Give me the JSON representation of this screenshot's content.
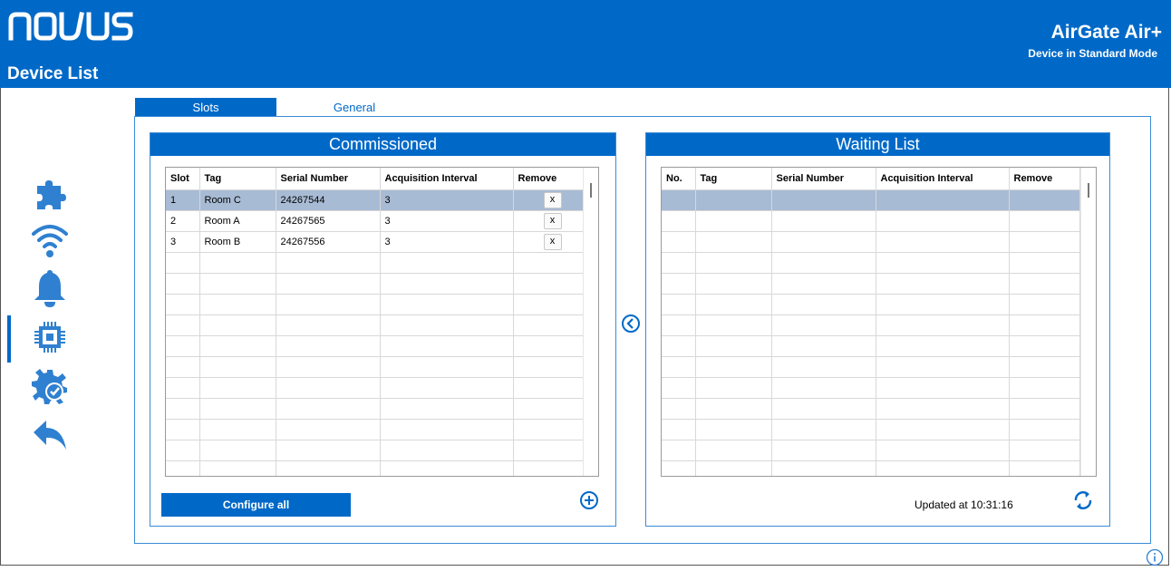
{
  "header": {
    "logo_text": "novus",
    "page_title": "Device List",
    "app_name": "AirGate Air+",
    "app_mode": "Device in Standard Mode"
  },
  "sidebar": {
    "items": [
      {
        "icon": "puzzle-icon"
      },
      {
        "icon": "wifi-icon"
      },
      {
        "icon": "bell-icon"
      },
      {
        "icon": "chip-icon",
        "active": true
      },
      {
        "icon": "gear-check-icon"
      },
      {
        "icon": "back-arrow-icon"
      }
    ]
  },
  "tabs": [
    {
      "label": "Slots",
      "active": true
    },
    {
      "label": "General",
      "active": false
    }
  ],
  "commissioned": {
    "title": "Commissioned",
    "columns": [
      "Slot",
      "Tag",
      "Serial Number",
      "Acquisition Interval",
      "Remove"
    ],
    "rows": [
      {
        "slot": "1",
        "tag": "Room C",
        "serial": "24267544",
        "interval": "3",
        "remove": "x",
        "selected": true
      },
      {
        "slot": "2",
        "tag": "Room A",
        "serial": "24267565",
        "interval": "3",
        "remove": "x",
        "selected": false
      },
      {
        "slot": "3",
        "tag": "Room B",
        "serial": "24267556",
        "interval": "3",
        "remove": "x",
        "selected": false
      }
    ],
    "configure_label": "Configure all"
  },
  "waiting": {
    "title": "Waiting List",
    "columns": [
      "No.",
      "Tag",
      "Serial Number",
      "Acquisition Interval",
      "Remove"
    ],
    "updated_text": "Updated at 10:31:16"
  },
  "colors": {
    "primary": "#0069c8",
    "selected_row": "#a8bbd4",
    "border": "#3a8bd6"
  }
}
